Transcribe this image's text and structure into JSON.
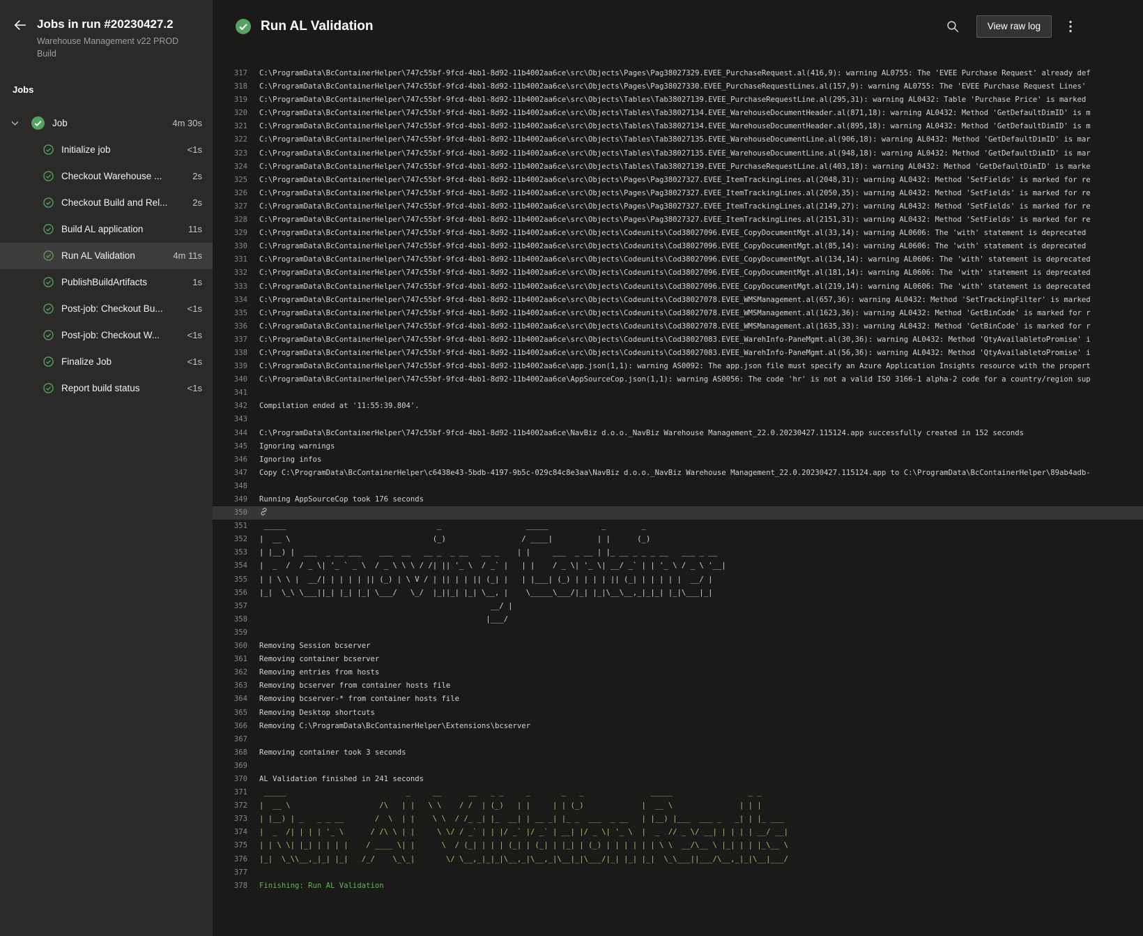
{
  "colors": {
    "success": "#55a362",
    "log_green": "#5bb75b",
    "art_yellow": "#b5bd68"
  },
  "sidebar": {
    "title": "Jobs in run #20230427.2",
    "subtitle": "Warehouse Management v22 PROD Build",
    "jobs_label": "Jobs",
    "items": [
      {
        "label": "Job",
        "duration": "4m 30s",
        "parent": true
      },
      {
        "label": "Initialize job",
        "duration": "<1s"
      },
      {
        "label": "Checkout Warehouse ...",
        "duration": "2s"
      },
      {
        "label": "Checkout Build and Rel...",
        "duration": "2s"
      },
      {
        "label": "Build AL application",
        "duration": "11s"
      },
      {
        "label": "Run AL Validation",
        "duration": "4m 11s",
        "selected": true
      },
      {
        "label": "PublishBuildArtifacts",
        "duration": "1s"
      },
      {
        "label": "Post-job: Checkout Bu...",
        "duration": "<1s"
      },
      {
        "label": "Post-job: Checkout W...",
        "duration": "<1s"
      },
      {
        "label": "Finalize Job",
        "duration": "<1s"
      },
      {
        "label": "Report build status",
        "duration": "<1s"
      }
    ]
  },
  "header": {
    "title": "Run AL Validation",
    "view_raw_log": "View raw log"
  },
  "log": {
    "lines": [
      {
        "n": 317,
        "t": "C:\\ProgramData\\BcContainerHelper\\747c55bf-9fcd-4bb1-8d92-11b4002aa6ce\\src\\Objects\\Pages\\Pag38027329.EVEE_PurchaseRequest.al(416,9): warning AL0755: The 'EVEE Purchase Request' already def"
      },
      {
        "n": 318,
        "t": "C:\\ProgramData\\BcContainerHelper\\747c55bf-9fcd-4bb1-8d92-11b4002aa6ce\\src\\Objects\\Pages\\Pag38027330.EVEE_PurchaseRequestLines.al(157,9): warning AL0755: The 'EVEE Purchase Request Lines'"
      },
      {
        "n": 319,
        "t": "C:\\ProgramData\\BcContainerHelper\\747c55bf-9fcd-4bb1-8d92-11b4002aa6ce\\src\\Objects\\Tables\\Tab38027139.EVEE_PurchaseRequestLine.al(295,31): warning AL0432: Table 'Purchase Price' is marked"
      },
      {
        "n": 320,
        "t": "C:\\ProgramData\\BcContainerHelper\\747c55bf-9fcd-4bb1-8d92-11b4002aa6ce\\src\\Objects\\Tables\\Tab38027134.EVEE_WarehouseDocumentHeader.al(871,18): warning AL0432: Method 'GetDefaultDimID' is m"
      },
      {
        "n": 321,
        "t": "C:\\ProgramData\\BcContainerHelper\\747c55bf-9fcd-4bb1-8d92-11b4002aa6ce\\src\\Objects\\Tables\\Tab38027134.EVEE_WarehouseDocumentHeader.al(895,18): warning AL0432: Method 'GetDefaultDimID' is m"
      },
      {
        "n": 322,
        "t": "C:\\ProgramData\\BcContainerHelper\\747c55bf-9fcd-4bb1-8d92-11b4002aa6ce\\src\\Objects\\Tables\\Tab38027135.EVEE_WarehouseDocumentLine.al(906,18): warning AL0432: Method 'GetDefaultDimID' is mar"
      },
      {
        "n": 323,
        "t": "C:\\ProgramData\\BcContainerHelper\\747c55bf-9fcd-4bb1-8d92-11b4002aa6ce\\src\\Objects\\Tables\\Tab38027135.EVEE_WarehouseDocumentLine.al(948,18): warning AL0432: Method 'GetDefaultDimID' is mar"
      },
      {
        "n": 324,
        "t": "C:\\ProgramData\\BcContainerHelper\\747c55bf-9fcd-4bb1-8d92-11b4002aa6ce\\src\\Objects\\Tables\\Tab38027139.EVEE_PurchaseRequestLine.al(403,18): warning AL0432: Method 'GetDefaultDimID' is marke"
      },
      {
        "n": 325,
        "t": "C:\\ProgramData\\BcContainerHelper\\747c55bf-9fcd-4bb1-8d92-11b4002aa6ce\\src\\Objects\\Pages\\Pag38027327.EVEE_ItemTrackingLines.al(2048,31): warning AL0432: Method 'SetFields' is marked for re"
      },
      {
        "n": 326,
        "t": "C:\\ProgramData\\BcContainerHelper\\747c55bf-9fcd-4bb1-8d92-11b4002aa6ce\\src\\Objects\\Pages\\Pag38027327.EVEE_ItemTrackingLines.al(2050,35): warning AL0432: Method 'SetFields' is marked for re"
      },
      {
        "n": 327,
        "t": "C:\\ProgramData\\BcContainerHelper\\747c55bf-9fcd-4bb1-8d92-11b4002aa6ce\\src\\Objects\\Pages\\Pag38027327.EVEE_ItemTrackingLines.al(2149,27): warning AL0432: Method 'SetFields' is marked for re"
      },
      {
        "n": 328,
        "t": "C:\\ProgramData\\BcContainerHelper\\747c55bf-9fcd-4bb1-8d92-11b4002aa6ce\\src\\Objects\\Pages\\Pag38027327.EVEE_ItemTrackingLines.al(2151,31): warning AL0432: Method 'SetFields' is marked for re"
      },
      {
        "n": 329,
        "t": "C:\\ProgramData\\BcContainerHelper\\747c55bf-9fcd-4bb1-8d92-11b4002aa6ce\\src\\Objects\\Codeunits\\Cod38027096.EVEE_CopyDocumentMgt.al(33,14): warning AL0606: The 'with' statement is deprecated"
      },
      {
        "n": 330,
        "t": "C:\\ProgramData\\BcContainerHelper\\747c55bf-9fcd-4bb1-8d92-11b4002aa6ce\\src\\Objects\\Codeunits\\Cod38027096.EVEE_CopyDocumentMgt.al(85,14): warning AL0606: The 'with' statement is deprecated"
      },
      {
        "n": 331,
        "t": "C:\\ProgramData\\BcContainerHelper\\747c55bf-9fcd-4bb1-8d92-11b4002aa6ce\\src\\Objects\\Codeunits\\Cod38027096.EVEE_CopyDocumentMgt.al(134,14): warning AL0606: The 'with' statement is deprecated"
      },
      {
        "n": 332,
        "t": "C:\\ProgramData\\BcContainerHelper\\747c55bf-9fcd-4bb1-8d92-11b4002aa6ce\\src\\Objects\\Codeunits\\Cod38027096.EVEE_CopyDocumentMgt.al(181,14): warning AL0606: The 'with' statement is deprecated"
      },
      {
        "n": 333,
        "t": "C:\\ProgramData\\BcContainerHelper\\747c55bf-9fcd-4bb1-8d92-11b4002aa6ce\\src\\Objects\\Codeunits\\Cod38027096.EVEE_CopyDocumentMgt.al(219,14): warning AL0606: The 'with' statement is deprecated"
      },
      {
        "n": 334,
        "t": "C:\\ProgramData\\BcContainerHelper\\747c55bf-9fcd-4bb1-8d92-11b4002aa6ce\\src\\Objects\\Codeunits\\Cod38027078.EVEE_WMSManagement.al(657,36): warning AL0432: Method 'SetTrackingFilter' is marked"
      },
      {
        "n": 335,
        "t": "C:\\ProgramData\\BcContainerHelper\\747c55bf-9fcd-4bb1-8d92-11b4002aa6ce\\src\\Objects\\Codeunits\\Cod38027078.EVEE_WMSManagement.al(1623,36): warning AL0432: Method 'GetBinCode' is marked for r"
      },
      {
        "n": 336,
        "t": "C:\\ProgramData\\BcContainerHelper\\747c55bf-9fcd-4bb1-8d92-11b4002aa6ce\\src\\Objects\\Codeunits\\Cod38027078.EVEE_WMSManagement.al(1635,33): warning AL0432: Method 'GetBinCode' is marked for r"
      },
      {
        "n": 337,
        "t": "C:\\ProgramData\\BcContainerHelper\\747c55bf-9fcd-4bb1-8d92-11b4002aa6ce\\src\\Objects\\Codeunits\\Cod38027083.EVEE_WarehInfo-PaneMgmt.al(30,36): warning AL0432: Method 'QtyAvailabletoPromise' i"
      },
      {
        "n": 338,
        "t": "C:\\ProgramData\\BcContainerHelper\\747c55bf-9fcd-4bb1-8d92-11b4002aa6ce\\src\\Objects\\Codeunits\\Cod38027083.EVEE_WarehInfo-PaneMgmt.al(56,36): warning AL0432: Method 'QtyAvailabletoPromise' i"
      },
      {
        "n": 339,
        "t": "C:\\ProgramData\\BcContainerHelper\\747c55bf-9fcd-4bb1-8d92-11b4002aa6ce\\app.json(1,1): warning AS0092: The app.json file must specify an Azure Application Insights resource with the propert"
      },
      {
        "n": 340,
        "t": "C:\\ProgramData\\BcContainerHelper\\747c55bf-9fcd-4bb1-8d92-11b4002aa6ce\\AppSourceCop.json(1,1): warning AS0056: The code 'hr' is not a valid ISO 3166-1 alpha-2 code for a country/region sup"
      },
      {
        "n": 341,
        "t": ""
      },
      {
        "n": 342,
        "t": "Compilation ended at '11:55:39.804'."
      },
      {
        "n": 343,
        "t": ""
      },
      {
        "n": 344,
        "t": "C:\\ProgramData\\BcContainerHelper\\747c55bf-9fcd-4bb1-8d92-11b4002aa6ce\\NavBiz d.o.o._NavBiz Warehouse Management_22.0.20230427.115124.app successfully created in 152 seconds"
      },
      {
        "n": 345,
        "t": "Ignoring warnings"
      },
      {
        "n": 346,
        "t": "Ignoring infos"
      },
      {
        "n": 347,
        "t": "Copy C:\\ProgramData\\BcContainerHelper\\c6438e43-5bdb-4197-9b5c-029c84c8e3aa\\NavBiz d.o.o._NavBiz Warehouse Management_22.0.20230427.115124.app to C:\\ProgramData\\BcContainerHelper\\89ab4adb-"
      },
      {
        "n": 348,
        "t": ""
      },
      {
        "n": 349,
        "t": "Running AppSourceCop took 176 seconds"
      },
      {
        "n": 350,
        "t": "",
        "hl": true,
        "icon": "link"
      },
      {
        "n": 351,
        "t": " _____                                  _                   _____            _        _",
        "c": "art"
      },
      {
        "n": 352,
        "t": "|  __ \\                                (_)                 / ____|          | |      (_)",
        "c": "art"
      },
      {
        "n": 353,
        "t": "| |__) |  ___  _ __ ___    ___  __   __ _  _ __   __ _    | |     ___  _ __ | |_ __ _ _ _ __   ___ _ __",
        "c": "art"
      },
      {
        "n": 354,
        "t": "|  _  /  / _ \\| '_ ` _ \\  / _ \\ \\ \\ / /| || '_ \\  / _` |   | |    / _ \\| '_ \\| __/ _` | | '_ \\ / _ \\ '__|",
        "c": "art"
      },
      {
        "n": 355,
        "t": "| | \\ \\ |  __/| | | | | || (_) | \\ V / | || | | || (_| |   | |___| (_) | | | | || (_| | | | | |  __/ |",
        "c": "art"
      },
      {
        "n": 356,
        "t": "|_|  \\_\\ \\___||_| |_| |_| \\___/   \\_/  |_||_| |_| \\__, |    \\_____\\___/|_| |_|\\__\\__,_|_|_| |_|\\___|_|",
        "c": "art"
      },
      {
        "n": 357,
        "t": "                                                    __/ |",
        "c": "art"
      },
      {
        "n": 358,
        "t": "                                                   |___/",
        "c": "art"
      },
      {
        "n": 359,
        "t": ""
      },
      {
        "n": 360,
        "t": "Removing Session bcserver"
      },
      {
        "n": 361,
        "t": "Removing container bcserver"
      },
      {
        "n": 362,
        "t": "Removing entries from hosts"
      },
      {
        "n": 363,
        "t": "Removing bcserver from container hosts file"
      },
      {
        "n": 364,
        "t": "Removing bcserver-* from container hosts file"
      },
      {
        "n": 365,
        "t": "Removing Desktop shortcuts"
      },
      {
        "n": 366,
        "t": "Removing C:\\ProgramData\\BcContainerHelper\\Extensions\\bcserver"
      },
      {
        "n": 367,
        "t": ""
      },
      {
        "n": 368,
        "t": "Removing container took 3 seconds"
      },
      {
        "n": 369,
        "t": ""
      },
      {
        "n": 370,
        "t": "AL Validation finished in 241 seconds"
      },
      {
        "n": 371,
        "t": " _____                           _     __      __   _ _     _       _   _               _____                 _ _",
        "c": "arty"
      },
      {
        "n": 372,
        "t": "|  __ \\                    /\\   | |   \\ \\    / /  | (_)   | |     | | (_)             |  __ \\               | | |",
        "c": "arty"
      },
      {
        "n": 373,
        "t": "| |__) | _   _ _ __       /  \\  | |    \\ \\  / /_ _| |_  __| | __ _| |_ _  ___  _ __   | |__) |___  ___ _   _| | |_ ___",
        "c": "arty"
      },
      {
        "n": 374,
        "t": "|  _  /| | | | '_ \\      / /\\ \\ | |     \\ \\/ / _` | | |/ _` |/ _` | __| |/ _ \\| '_ \\  |  _  // _ \\/ __| | | | | __/ __|",
        "c": "arty"
      },
      {
        "n": 375,
        "t": "| | \\ \\| |_| | | | |    / ____ \\| |      \\  / (_| | | | (_| | (_| | |_| | (_) | | | | | | \\ \\  __/\\__ \\ |_| | | |_\\__ \\",
        "c": "arty"
      },
      {
        "n": 376,
        "t": "|_|  \\_\\\\__,_|_| |_|   /_/    \\_\\_|       \\/ \\__,_|_|_|\\__,_|\\__,_|\\__|_|\\___/|_| |_| |_|  \\_\\___||___/\\__,_|_|\\__|___/",
        "c": "arty"
      },
      {
        "n": 377,
        "t": ""
      },
      {
        "n": 378,
        "t": "Finishing: Run AL Validation",
        "c": "ok"
      }
    ]
  }
}
